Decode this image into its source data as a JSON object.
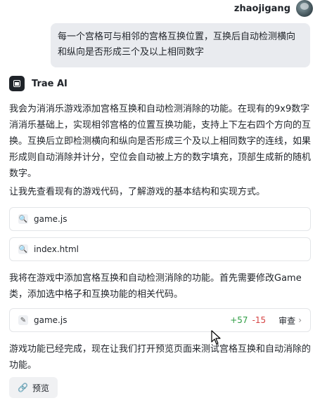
{
  "user": {
    "name": "zhaojigang",
    "message": "每一个宫格可与相邻的宫格互换位置，互换后自动检测横向和纵向是否形成三个及以上相同数字"
  },
  "assistant": {
    "name": "Trae AI",
    "paragraph1": "我会为消消乐游戏添加宫格互换和自动检测消除的功能。在现有的9x9数字消消乐基础上，实现相邻宫格的位置互换功能，支持上下左右四个方向的互换。互换后立即检测横向和纵向是否形成三个及以上相同数字的连线，如果形成则自动消除并计分，空位会自动被上方的数字填充，顶部生成新的随机数字。",
    "paragraph2": "让我先查看现有的游戏代码，了解游戏的基本结构和实现方式。",
    "file1": "game.js",
    "file2": "index.html",
    "paragraph3": "我将在游戏中添加宫格互换和自动检测消除的功能。首先需要修改Game类，添加选中格子和互换功能的相关代码。",
    "edit_file": "game.js",
    "additions": "+57",
    "deletions": "-15",
    "review_label": "审查",
    "paragraph4": "游戏功能已经完成，现在让我们打开预览页面来测试宫格互换和自动消除的功能。",
    "preview_label": "预览"
  }
}
